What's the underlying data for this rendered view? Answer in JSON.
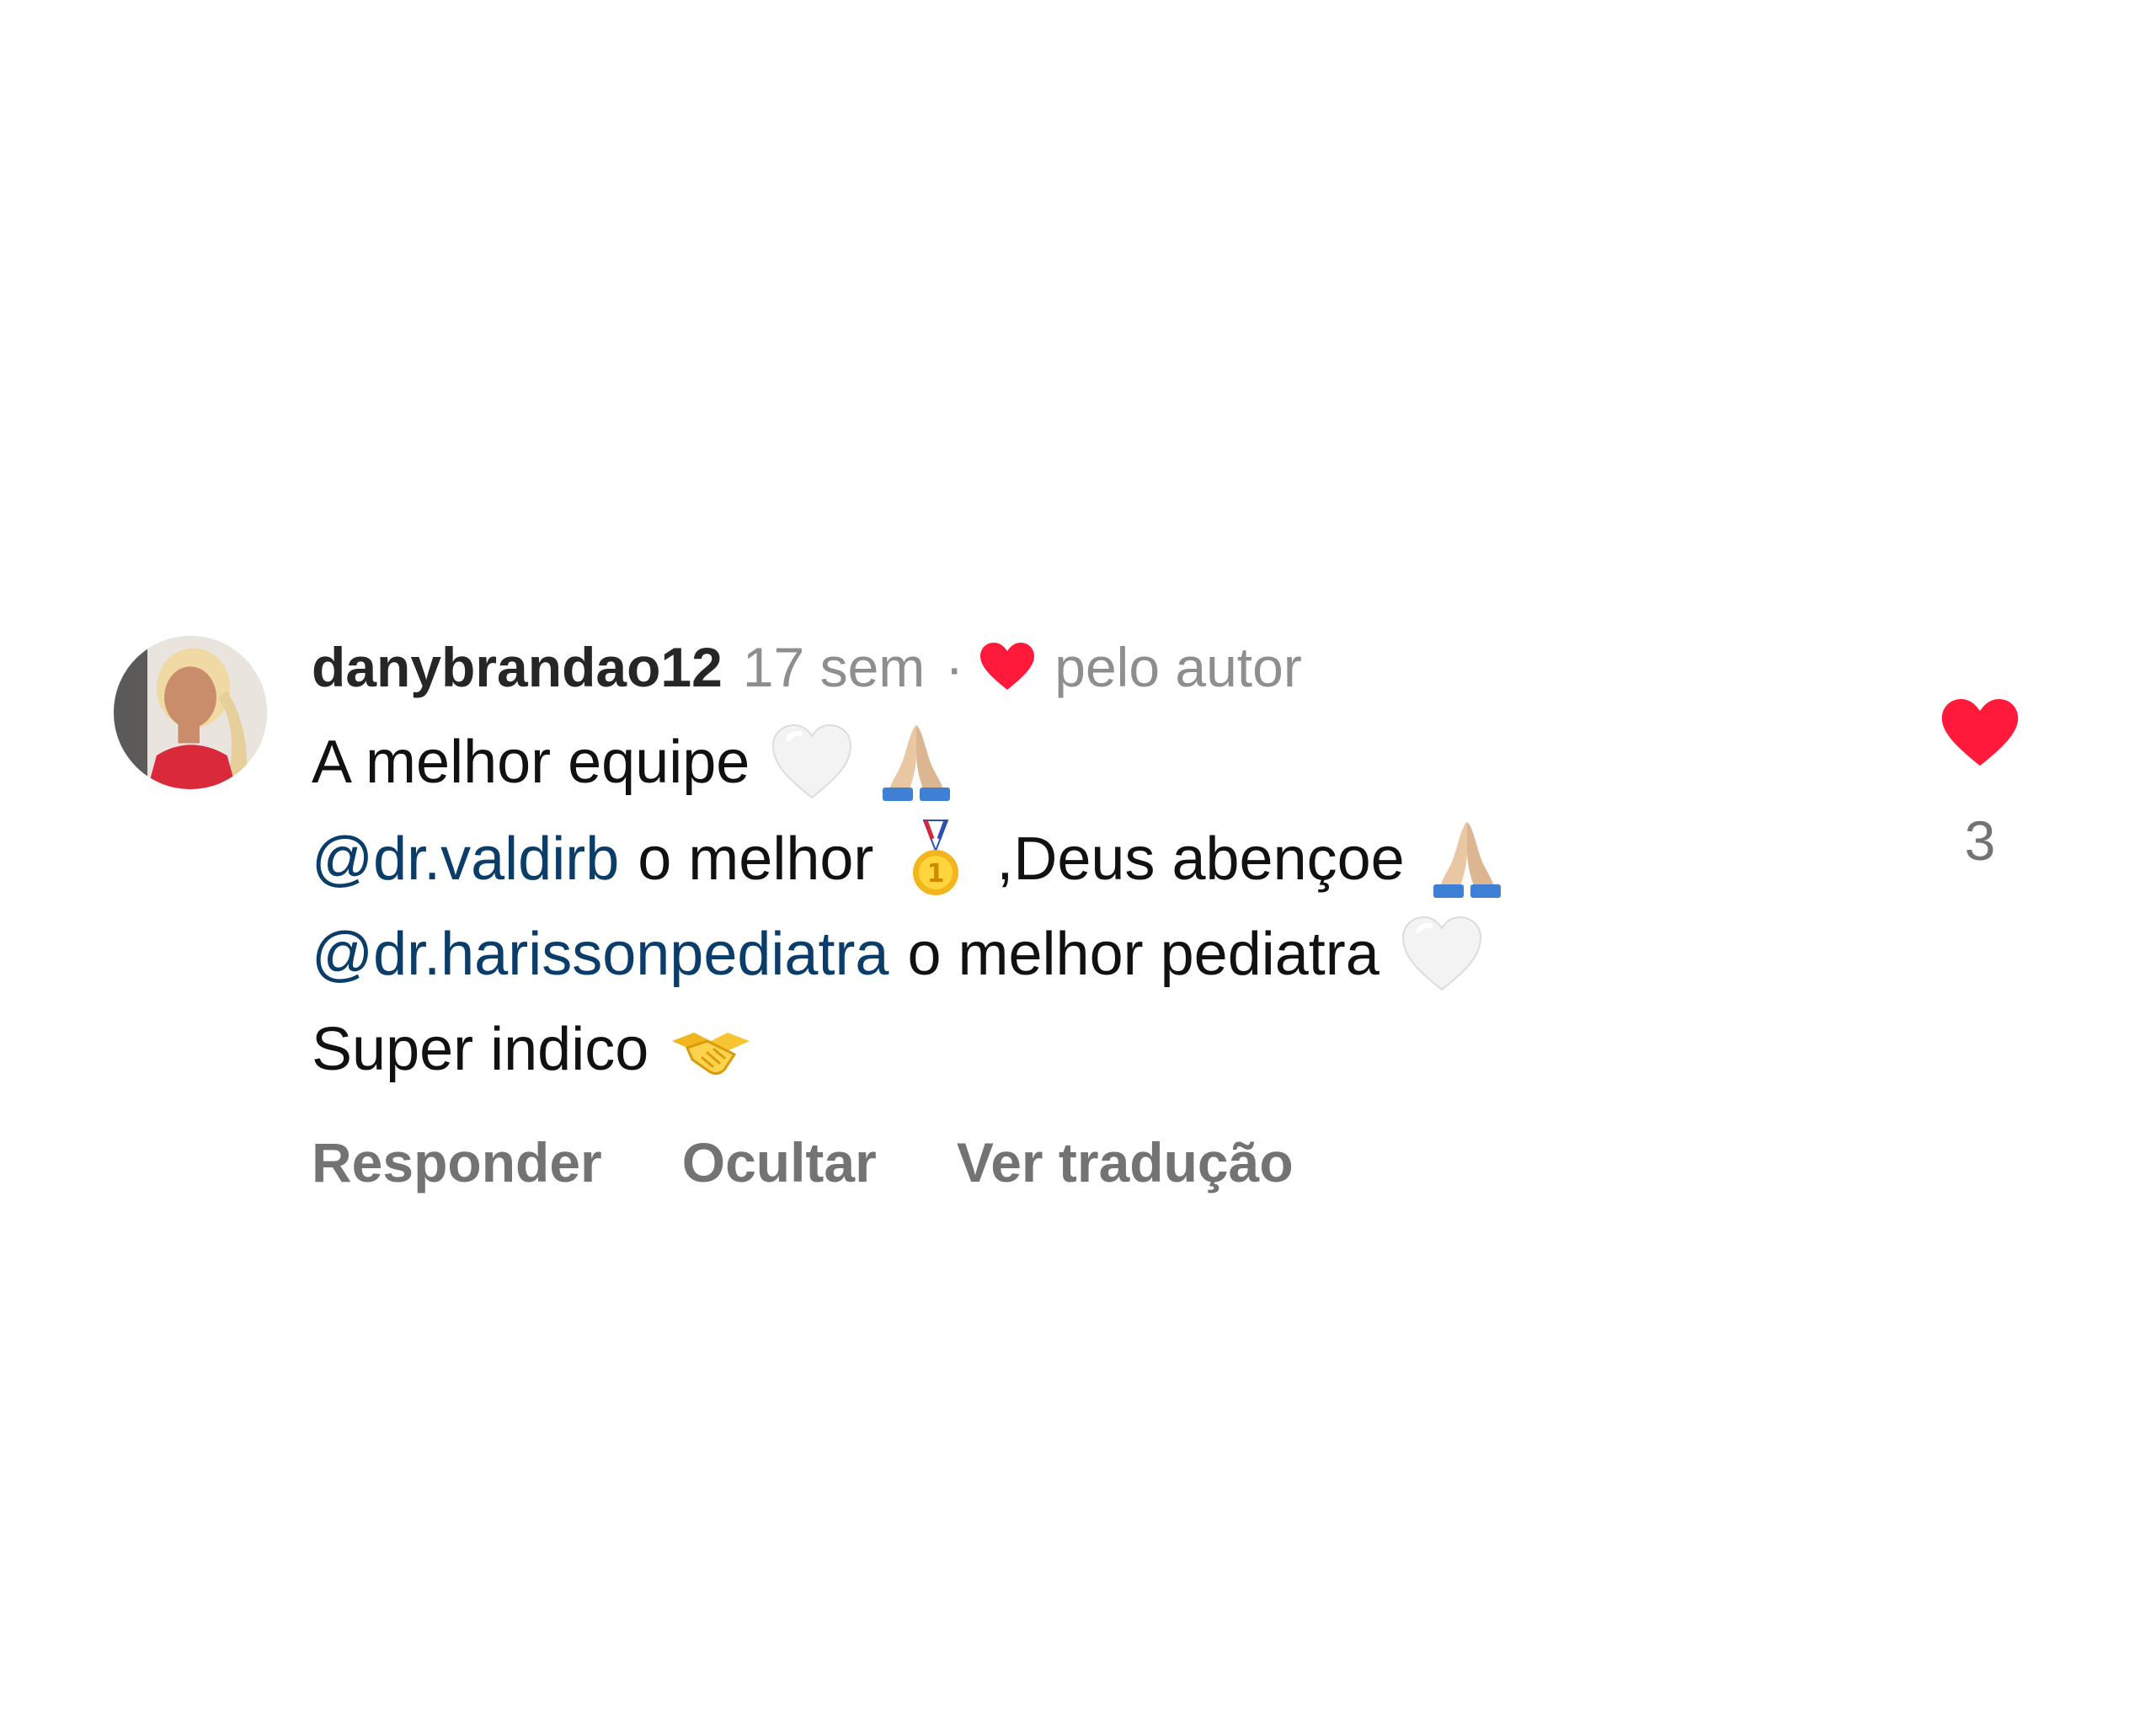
{
  "comment": {
    "username": "danybrandao12",
    "time": "17 sem",
    "separator": "·",
    "liked_by_author_label": "pelo autor",
    "lines": [
      {
        "text": "A melhor equipe"
      },
      {
        "mention": "@dr.valdirb",
        "text_before_emoji": "o melhor",
        "text_after_emoji": ",Deus abençoe"
      },
      {
        "mention": "@dr.harissonpediatra",
        "text": "o melhor pediatra"
      },
      {
        "text": "Super indico"
      }
    ],
    "emojis": {
      "line1": [
        "white-heart-icon",
        "praying-hands-icon"
      ],
      "line2": [
        "first-place-medal-icon",
        "praying-hands-icon"
      ],
      "line3": [
        "white-heart-icon"
      ],
      "line4": [
        "handshake-icon"
      ]
    }
  },
  "actions": {
    "reply": "Responder",
    "hide": "Ocultar",
    "translate": "Ver tradução"
  },
  "likes": {
    "count": "3",
    "liked": true
  },
  "colors": {
    "heart": "#ff1a3c",
    "mention": "#0b3d6b",
    "secondary_text": "#8e8e8e"
  }
}
